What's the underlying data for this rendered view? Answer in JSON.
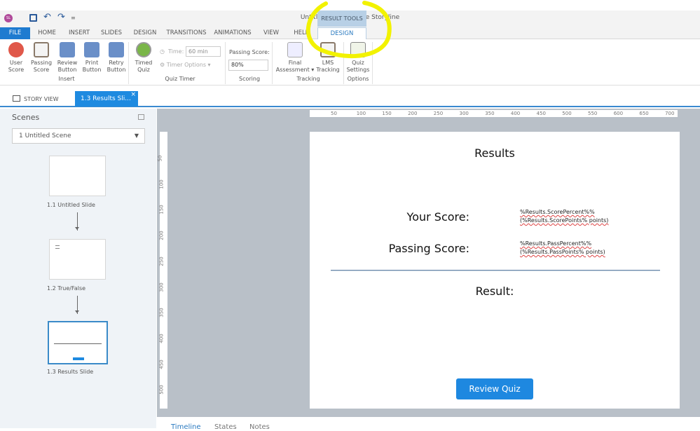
{
  "app": {
    "title": "Untitled1* - Articulate Storyline",
    "logo": "SL"
  },
  "quick_access": [
    "save-icon",
    "undo-icon",
    "redo-icon",
    "customize-icon"
  ],
  "ribbon_tabs": [
    "FILE",
    "HOME",
    "INSERT",
    "SLIDES",
    "DESIGN",
    "TRANSITIONS",
    "ANIMATIONS",
    "VIEW",
    "HELP"
  ],
  "contextual": {
    "header": "RESULT TOOLS",
    "tab": "DESIGN"
  },
  "ribbon": {
    "insert": {
      "user_score": "User Score",
      "passing_score": "Passing Score",
      "review_button": "Review Button",
      "print_button": "Print Button",
      "retry_button": "Retry Button",
      "group": "Insert"
    },
    "quiz_timer": {
      "timed_quiz": "Timed Quiz",
      "time_label": "Time:",
      "time_value": "60 min",
      "timer_options": "Timer Options",
      "group": "Quiz Timer"
    },
    "scoring": {
      "label": "Passing Score:",
      "value": "80%",
      "group": "Scoring"
    },
    "tracking": {
      "final_assessment": "Final Assessment",
      "lms_tracking": "LMS Tracking",
      "group": "Tracking"
    },
    "options": {
      "quiz_settings": "Quiz Settings",
      "group": "Options"
    }
  },
  "doc_tabs": {
    "story_view": "STORY VIEW",
    "slide_tab": "1.3 Results Sli..."
  },
  "scenes": {
    "title": "Scenes",
    "selected": "1 Untitled Scene",
    "slides": [
      "1.1 Untitled Slide",
      "1.2 True/False",
      "1.3 Results Slide"
    ]
  },
  "rulers": {
    "h": [
      "50",
      "100",
      "150",
      "200",
      "250",
      "300",
      "350",
      "400",
      "450",
      "500",
      "550",
      "600",
      "650",
      "700"
    ],
    "v": [
      "50",
      "100",
      "150",
      "200",
      "250",
      "300",
      "350",
      "400",
      "450",
      "500"
    ]
  },
  "slide": {
    "title": "Results",
    "your_score": "Your Score:",
    "score_var1": "%Results.ScorePercent%%",
    "score_var2": "(%Results.ScorePoints% points)",
    "passing_score": "Passing Score:",
    "pass_var1": "%Results.PassPercent%%",
    "pass_var2": "(%Results.PassPoints% points)",
    "result": "Result:",
    "review_button": "Review Quiz"
  },
  "bottom_tabs": [
    "Timeline",
    "States",
    "Notes"
  ],
  "colors": {
    "accent": "#1e8ae0",
    "highlight": "#f2f200"
  }
}
